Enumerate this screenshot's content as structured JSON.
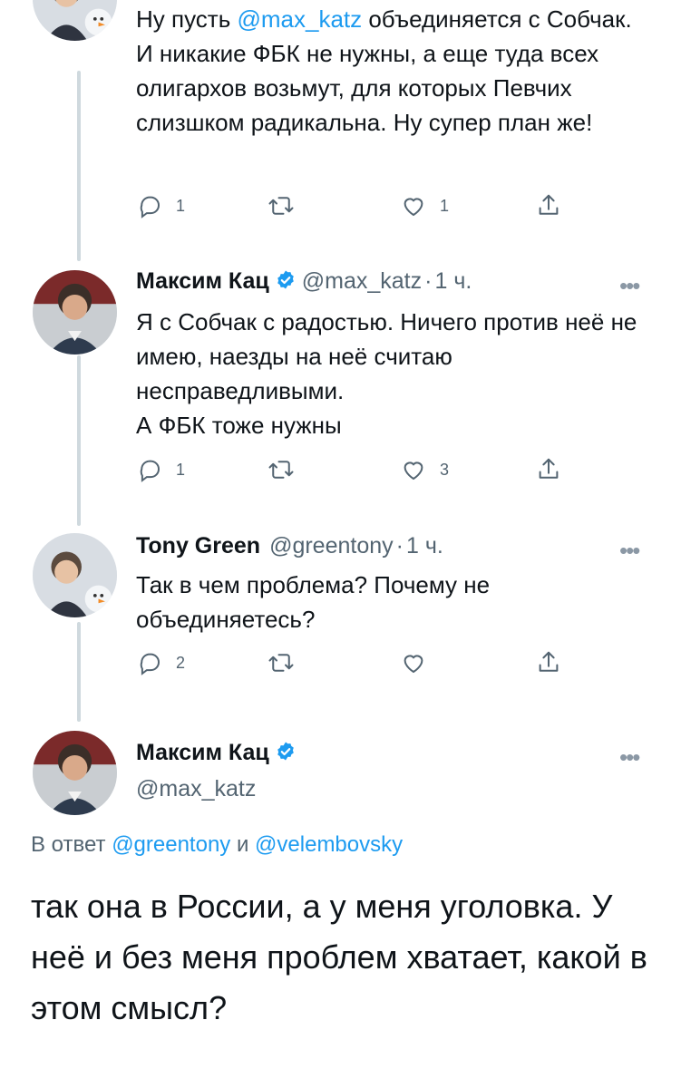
{
  "tweets": [
    {
      "text_parts": [
        "Ну пусть ",
        "@max_katz",
        " объединяется с Собчак. И никакие ФБК не нужны, а еще туда всех олигархов возьмут,  для которых Певчих слизшком радикальна. Ну супер план же!"
      ],
      "reply_count": "1",
      "retweet_count": "",
      "like_count": "1"
    },
    {
      "name": "Максим Кац",
      "handle": "@max_katz",
      "separator": "·",
      "time": "1 ч.",
      "text": "Я с Собчак с радостью. Ничего против неё не имею, наезды на неё считаю несправедливыми.\nА ФБК тоже нужны",
      "reply_count": "1",
      "retweet_count": "",
      "like_count": "3"
    },
    {
      "name": "Tony Green",
      "handle": "@greentony",
      "separator": "·",
      "time": "1 ч.",
      "text": "Так в чем проблема? Почему не объединяетесь?",
      "reply_count": "2",
      "retweet_count": "",
      "like_count": ""
    }
  ],
  "main_tweet": {
    "name": "Максим Кац",
    "handle": "@max_katz",
    "reply_prefix": "В ответ ",
    "reply_user1": "@greentony",
    "reply_joiner": " и ",
    "reply_user2": "@velembovsky",
    "text": "так она в России, а у меня уголовка. У неё и без меня проблем хватает, какой в этом смысл?"
  },
  "more_glyph": "•••",
  "colors": {
    "link": "#1d9bf0",
    "secondary": "#536471",
    "verified": "#1d9bf0",
    "thread_line": "#cfd9de"
  },
  "icons": [
    "reply-icon",
    "retweet-icon",
    "like-icon",
    "share-icon",
    "verified-icon",
    "more-icon"
  ]
}
